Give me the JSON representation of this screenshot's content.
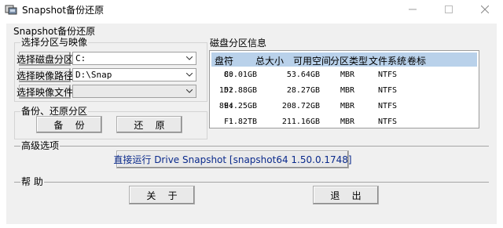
{
  "window": {
    "title": "Snapshot备份还原"
  },
  "main_group": {
    "title": "Snapshot备份还原"
  },
  "partition_section": {
    "title": "选择分区与映像",
    "select_partition_label": "选择磁盘分区",
    "select_partition_value": "C:",
    "image_path_label": "选择映像路径",
    "image_path_value": "D:\\Snap",
    "image_file_label": "选择映像文件",
    "image_file_value": ""
  },
  "backup_section": {
    "title": "备份、还原分区",
    "backup_label": "备    份",
    "restore_label": "还    原"
  },
  "disk_info": {
    "title": "磁盘分区信息",
    "columns": [
      "盘符",
      "总大小",
      "可用空间",
      "分区类型",
      "文件系统",
      "卷标"
    ],
    "rows": [
      [
        "C:",
        "80.01GB",
        "53.64GB",
        "MBR",
        "NTFS",
        ""
      ],
      [
        "D:",
        "152.88GB",
        "28.27GB",
        "MBR",
        "NTFS",
        ""
      ],
      [
        "E:",
        "894.25GB",
        "208.72GB",
        "MBR",
        "NTFS",
        ""
      ],
      [
        "F:",
        "1.82TB",
        "211.16GB",
        "MBR",
        "NTFS",
        ""
      ]
    ]
  },
  "advanced": {
    "title": "高级选项",
    "run_label": "直接运行 Drive Snapshot [snapshot64 1.50.0.1748]"
  },
  "help": {
    "title": "帮  助",
    "about_label": "关    于",
    "exit_label": "退    出"
  }
}
